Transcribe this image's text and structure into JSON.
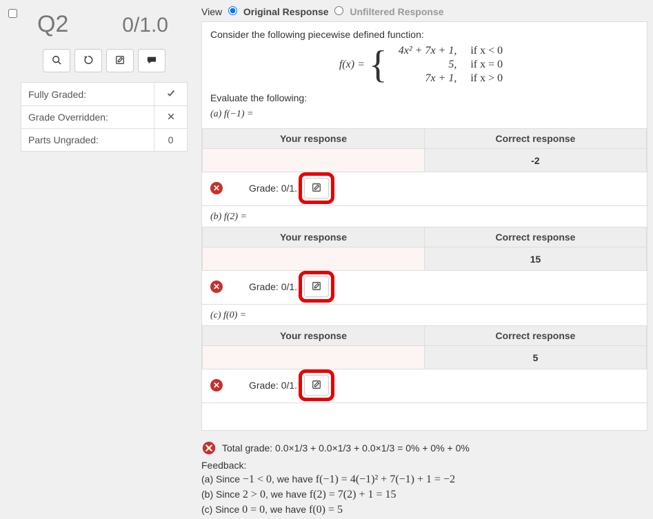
{
  "left": {
    "question_number": "Q2",
    "score": "0/1.0",
    "status": [
      {
        "label": "Fully Graded:",
        "icon": "check"
      },
      {
        "label": "Grade Overridden:",
        "icon": "x"
      },
      {
        "label": "Parts Ungraded:",
        "value": "0"
      }
    ]
  },
  "view": {
    "label": "View",
    "original": "Original Response",
    "unfiltered": "Unfiltered Response"
  },
  "prompt": {
    "intro": "Consider the following piecewise defined function:",
    "fx_label": "f(x) =",
    "piecewise": [
      {
        "expr": "4x² + 7x + 1,",
        "cond": "if  x < 0"
      },
      {
        "expr": "5,",
        "cond": "if  x = 0"
      },
      {
        "expr": "7x + 1,",
        "cond": "if  x > 0"
      }
    ],
    "evaluate": "Evaluate the following:"
  },
  "parts": [
    {
      "label": "(a) f(−1) =",
      "your": "",
      "correct": "-2",
      "grade": "Grade: 0/1."
    },
    {
      "label": "(b) f(2) =",
      "your": "",
      "correct": "15",
      "grade": "Grade: 0/1."
    },
    {
      "label": "(c) f(0) =",
      "your": "",
      "correct": "5",
      "grade": "Grade: 0/1."
    }
  ],
  "headers": {
    "your": "Your response",
    "correct": "Correct response"
  },
  "summary": {
    "total": "Total grade: 0.0×1/3 + 0.0×1/3 + 0.0×1/3 = 0% + 0% + 0%",
    "feedback_label": "Feedback:",
    "lines": {
      "a_pre": "(a) Since ",
      "a_math1": "−1 < 0",
      "a_mid": ", we have ",
      "a_math2": "f(−1) = 4(−1)² + 7(−1) + 1 = −2",
      "b_pre": "(b) Since ",
      "b_math1": "2 > 0",
      "b_mid": ", we have ",
      "b_math2": "f(2) = 7(2) + 1 = 15",
      "c_pre": "(c) Since ",
      "c_math1": "0 = 0",
      "c_mid": ", we have ",
      "c_math2": "f(0) = 5"
    }
  }
}
